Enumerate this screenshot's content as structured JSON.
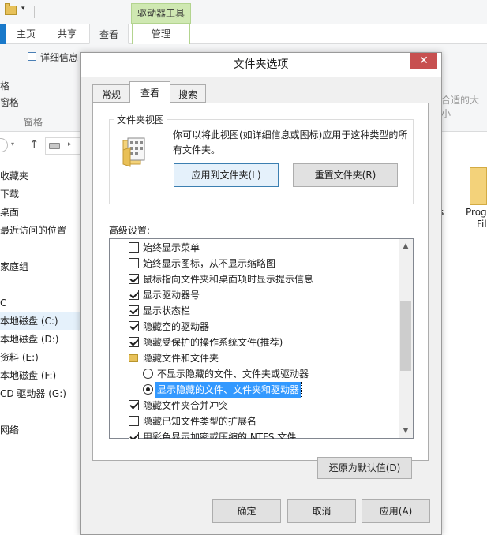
{
  "explorer": {
    "context_tab_header": "驱动器工具",
    "tabs": {
      "home": "主页",
      "share": "共享",
      "view": "查看",
      "manage": "管理"
    },
    "ribbon": {
      "details_pane": "详细信息",
      "small_item_1": "格",
      "small_item_2": "窗格",
      "group_label": "窗格",
      "fit_columns": "合适的大小"
    },
    "nav": {
      "favorites": "收藏夹",
      "downloads": "下载",
      "desktop": "桌面",
      "recent": "最近访问的位置",
      "homegroup": "家庭组",
      "pc": "C",
      "drive_c": "本地磁盘 (C:)",
      "drive_d": "本地磁盘 (D:)",
      "drive_e": "资料 (E:)",
      "drive_f": "本地磁盘 (F:)",
      "drive_g": "CD 驱动器 (G:)",
      "network": "网络"
    },
    "right_pane": {
      "s": "s",
      "prog": "Prog",
      "fi": "Fil"
    }
  },
  "dialog": {
    "title": "文件夹选项",
    "close_glyph": "✕",
    "tabs": {
      "general": "常规",
      "view": "查看",
      "search": "搜索"
    },
    "folder_view": {
      "legend": "文件夹视图",
      "description": "你可以将此视图(如详细信息或图标)应用于这种类型的所有文件夹。",
      "apply_button": "应用到文件夹(L)",
      "reset_button": "重置文件夹(R)"
    },
    "advanced": {
      "label": "高级设置:",
      "items": [
        {
          "type": "checkbox",
          "checked": false,
          "text": "始终显示菜单"
        },
        {
          "type": "checkbox",
          "checked": false,
          "text": "始终显示图标，从不显示缩略图"
        },
        {
          "type": "checkbox",
          "checked": true,
          "text": "鼠标指向文件夹和桌面项时显示提示信息"
        },
        {
          "type": "checkbox",
          "checked": true,
          "text": "显示驱动器号"
        },
        {
          "type": "checkbox",
          "checked": true,
          "text": "显示状态栏"
        },
        {
          "type": "checkbox",
          "checked": true,
          "text": "隐藏空的驱动器"
        },
        {
          "type": "checkbox",
          "checked": true,
          "text": "隐藏受保护的操作系统文件(推荐)"
        },
        {
          "type": "folder",
          "text": "隐藏文件和文件夹"
        },
        {
          "type": "radio",
          "checked": false,
          "text": "不显示隐藏的文件、文件夹或驱动器"
        },
        {
          "type": "radio",
          "checked": true,
          "selected": true,
          "text": "显示隐藏的文件、文件夹和驱动器"
        },
        {
          "type": "checkbox",
          "checked": true,
          "text": "隐藏文件夹合并冲突"
        },
        {
          "type": "checkbox",
          "checked": false,
          "text": "隐藏已知文件类型的扩展名"
        },
        {
          "type": "checkbox",
          "checked": true,
          "text": "用彩色显示加密或压缩的 NTFS 文件"
        }
      ]
    },
    "restore_defaults": "还原为默认值(D)",
    "buttons": {
      "ok": "确定",
      "cancel": "取消",
      "apply": "应用(A)"
    }
  }
}
